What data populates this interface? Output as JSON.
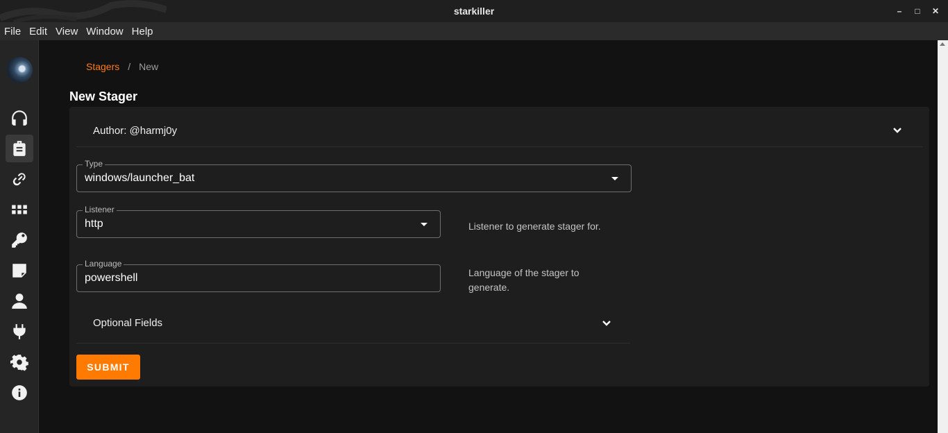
{
  "window": {
    "title": "starkiller"
  },
  "menu": [
    "File",
    "Edit",
    "View",
    "Window",
    "Help"
  ],
  "sidebar": {
    "items": [
      {
        "icon": "headphones-icon",
        "active": false
      },
      {
        "icon": "briefcase-icon",
        "active": true
      },
      {
        "icon": "link-icon",
        "active": false
      },
      {
        "icon": "grid-icon",
        "active": false
      },
      {
        "icon": "key-icon",
        "active": false
      },
      {
        "icon": "note-icon",
        "active": false
      },
      {
        "icon": "user-icon",
        "active": false
      },
      {
        "icon": "plug-icon",
        "active": false
      },
      {
        "icon": "gear-icon",
        "active": false
      },
      {
        "icon": "info-icon",
        "active": false
      }
    ]
  },
  "breadcrumb": {
    "parent": "Stagers",
    "separator": "/",
    "current": "New"
  },
  "page": {
    "title": "New Stager"
  },
  "form": {
    "author": "Author: @harmj0y",
    "type": {
      "label": "Type",
      "value": "windows/launcher_bat"
    },
    "listener": {
      "label": "Listener",
      "value": "http",
      "hint": "Listener to generate stager for."
    },
    "language": {
      "label": "Language",
      "value": "powershell",
      "hint": "Language of the stager to generate."
    },
    "optional": "Optional Fields",
    "submit": "SUBMIT"
  },
  "colors": {
    "accent": "#ff7a00",
    "link": "#ff7a1a",
    "background": "#121212",
    "card": "#1e1e1e"
  }
}
